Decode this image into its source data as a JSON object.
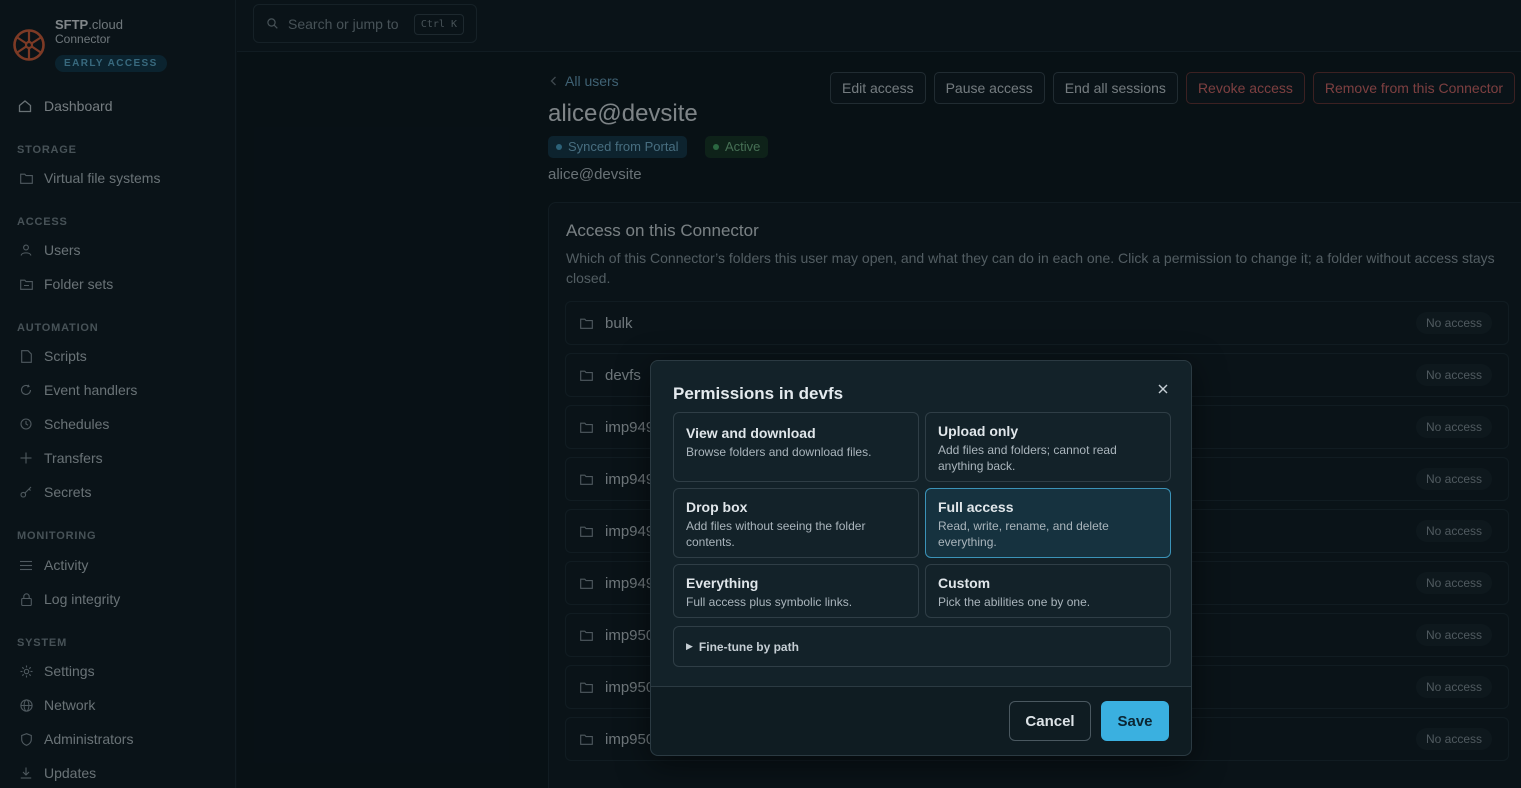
{
  "brand": {
    "name_bold": "SFTP",
    "name_light": ".cloud",
    "product": "Connector",
    "badge": "EARLY ACCESS",
    "accent": "#e0623a"
  },
  "sidebar": {
    "dashboard": "Dashboard",
    "sections": [
      {
        "title": "STORAGE",
        "items": [
          "Virtual file systems"
        ]
      },
      {
        "title": "ACCESS",
        "items": [
          "Users",
          "Folder sets"
        ]
      },
      {
        "title": "AUTOMATION",
        "items": [
          "Scripts",
          "Event handlers",
          "Schedules",
          "Transfers",
          "Secrets"
        ]
      },
      {
        "title": "MONITORING",
        "items": [
          "Activity",
          "Log integrity"
        ]
      },
      {
        "title": "SYSTEM",
        "items": [
          "Settings",
          "Network",
          "Administrators",
          "Updates"
        ]
      }
    ]
  },
  "search": {
    "placeholder": "Search or jump to",
    "shortcut": "Ctrl K"
  },
  "page": {
    "back_label": "All users",
    "title": "alice@devsite",
    "tag_synced": "Synced from Portal",
    "tag_active": "Active",
    "subtitle": "alice@devsite",
    "actions": {
      "edit": "Edit access",
      "pause": "Pause access",
      "end_sessions": "End all sessions",
      "revoke": "Revoke access",
      "remove": "Remove from this Connector"
    }
  },
  "access_card": {
    "title": "Access on this Connector",
    "description": "Which of this Connector’s folders this user may open, and what they can do in each one. Click a permission to change it; a folder without access stays closed.",
    "folders": [
      {
        "name": "bulk",
        "status": "No access"
      },
      {
        "name": "devfs",
        "status": "No access"
      },
      {
        "name": "imp949",
        "status": "No access"
      },
      {
        "name": "imp949",
        "status": "No access"
      },
      {
        "name": "imp949",
        "status": "No access"
      },
      {
        "name": "imp949",
        "status": "No access"
      },
      {
        "name": "imp950",
        "status": "No access"
      },
      {
        "name": "imp950",
        "status": "No access"
      },
      {
        "name": "imp950",
        "status": "No access"
      }
    ]
  },
  "modal": {
    "title": "Permissions in devfs",
    "options": [
      {
        "title": "View and download",
        "desc": "Browse folders and download files."
      },
      {
        "title": "Upload only",
        "desc": "Add files and folders; cannot read anything back."
      },
      {
        "title": "Drop box",
        "desc": "Add files without seeing the folder contents."
      },
      {
        "title": "Full access",
        "desc": "Read, write, rename, and delete everything."
      },
      {
        "title": "Everything",
        "desc": "Full access plus symbolic links."
      },
      {
        "title": "Custom",
        "desc": "Pick the abilities one by one."
      }
    ],
    "selected": "Full access",
    "finetune": "Fine-tune by path",
    "cancel": "Cancel",
    "save": "Save"
  }
}
